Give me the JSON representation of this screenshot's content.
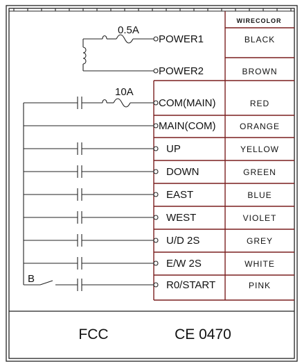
{
  "header": {
    "wire_color_title": "WIRECOLOR"
  },
  "ratings": {
    "fuse_small": "0.5A",
    "fuse_large": "10A",
    "switch_b": "B"
  },
  "terminals": [
    {
      "label": "POWER1",
      "color": "BLACK",
      "symbol": "fuse-0.5A"
    },
    {
      "label": "POWER2",
      "color": "BROWN",
      "symbol": "coil"
    },
    {
      "label": "COM(MAIN)",
      "color": "RED",
      "symbol": "contact-fuse-10A"
    },
    {
      "label": "MAIN(COM)",
      "color": "ORANGE",
      "symbol": "direct"
    },
    {
      "label": "UP",
      "color": "YELLOW",
      "symbol": "contact"
    },
    {
      "label": "DOWN",
      "color": "GREEN",
      "symbol": "contact"
    },
    {
      "label": "EAST",
      "color": "BLUE",
      "symbol": "contact"
    },
    {
      "label": "WEST",
      "color": "VIOLET",
      "symbol": "contact"
    },
    {
      "label": "U/D 2S",
      "color": "GREY",
      "symbol": "contact"
    },
    {
      "label": "E/W 2S",
      "color": "WHITE",
      "symbol": "contact"
    },
    {
      "label": "R0/START",
      "color": "PINK",
      "symbol": "contact-switch-B"
    }
  ],
  "footer": {
    "fcc": "FCC",
    "ce": "CE 0470"
  },
  "colors": {
    "frame": "#222222",
    "wire": "#222222",
    "table_lines": "#7a1f1f"
  }
}
